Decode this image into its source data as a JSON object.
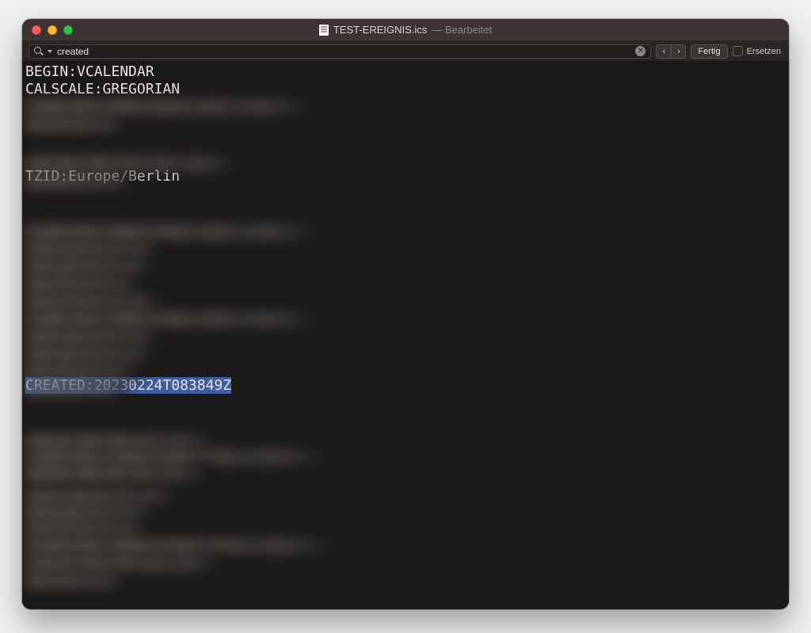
{
  "window": {
    "filename": "TEST-EREIGNIS.ics",
    "subtitle": "— Bearbeitet"
  },
  "findbar": {
    "query": "created",
    "done_label": "Fertig",
    "replace_label": "Ersetzen"
  },
  "editor": {
    "line1": "BEGIN:VCALENDAR",
    "line2": "CALSCALE:GREGORIAN",
    "line_tzid": "TZID:Europe/Berlin",
    "line_created": "CREATED:20230224T083849Z"
  }
}
